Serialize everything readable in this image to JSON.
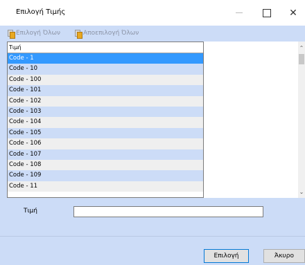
{
  "window": {
    "title": "Επιλογή Τιμής"
  },
  "toolbar": {
    "select_all": "Επιλογή Όλων",
    "deselect_all": "Αποεπιλογή Όλων"
  },
  "list": {
    "header": "Τιμή",
    "rows": [
      "Code - 1",
      "Code - 10",
      "Code - 100",
      "Code - 101",
      "Code - 102",
      "Code - 103",
      "Code - 104",
      "Code - 105",
      "Code - 106",
      "Code - 107",
      "Code - 108",
      "Code - 109",
      "Code - 11"
    ],
    "selected_index": 0
  },
  "form": {
    "value_label": "Τιμή",
    "value_input": ""
  },
  "buttons": {
    "ok": "Επιλογή",
    "cancel": "Άκυρο"
  },
  "colors": {
    "panel_bg": "#ccdcf7",
    "selected_row": "#3399ff",
    "alt_row": "#efefef"
  }
}
